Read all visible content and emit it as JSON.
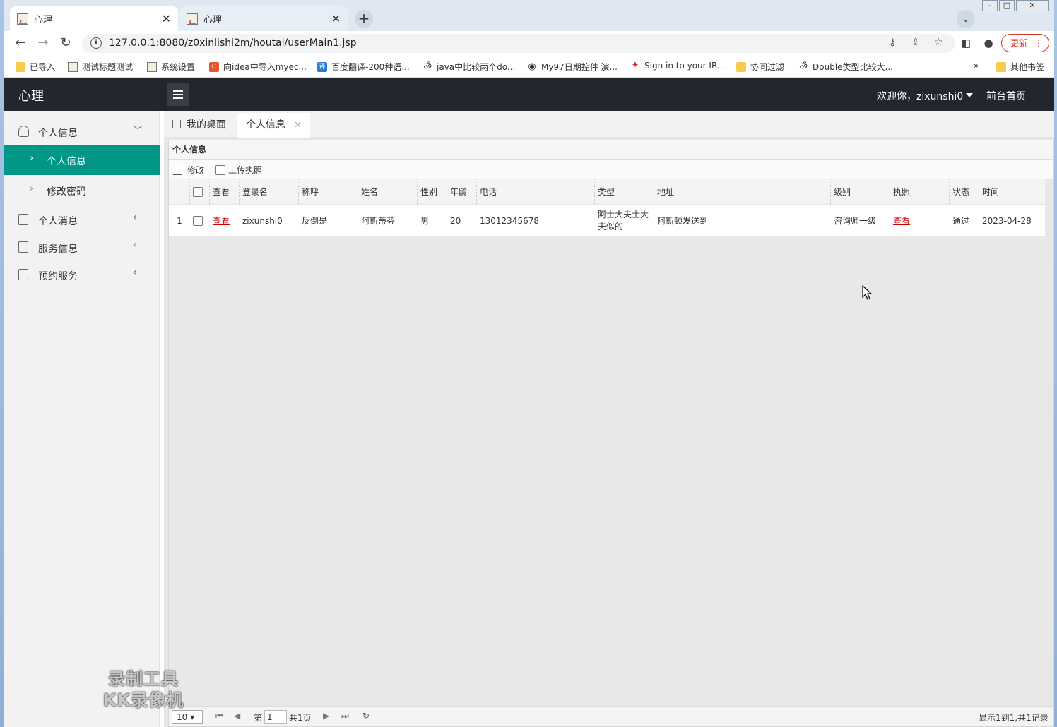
{
  "browser": {
    "tabs": [
      {
        "title": "心理"
      },
      {
        "title": "心理"
      }
    ],
    "url": "127.0.0.1:8080/z0xinlishi2m/houtai/userMain1.jsp",
    "update_label": "更新",
    "bookmarks": [
      {
        "label": "已导入",
        "icon": "folder-icon"
      },
      {
        "label": "测试标题测试",
        "icon": "page-icon"
      },
      {
        "label": "系统设置",
        "icon": "page-icon"
      },
      {
        "label": "向idea中导入myec...",
        "icon": "csdn-icon"
      },
      {
        "label": "百度翻译-200种语...",
        "icon": "translate-icon"
      },
      {
        "label": "java中比较两个do...",
        "icon": "om-icon"
      },
      {
        "label": "My97日期控件 演...",
        "icon": "globe-icon"
      },
      {
        "label": "Sign in to your IR...",
        "icon": "maple-leaf-icon"
      },
      {
        "label": "协同过滤",
        "icon": "folder-icon"
      },
      {
        "label": "Double类型比较大...",
        "icon": "om-icon"
      }
    ],
    "more_bookmarks": "»",
    "other_bookmarks": "其他书签"
  },
  "header": {
    "logo": "心理",
    "welcome": "欢迎你，zixunshi0",
    "home_link": "前台首页"
  },
  "sidebar": {
    "groups": [
      {
        "label": "个人信息",
        "icon": "user-icon",
        "expanded": true,
        "items": [
          {
            "label": "个人信息",
            "active": true
          },
          {
            "label": "修改密码",
            "active": false
          }
        ]
      },
      {
        "label": "个人消息",
        "icon": "document-icon",
        "expanded": false
      },
      {
        "label": "服务信息",
        "icon": "document-icon",
        "expanded": false
      },
      {
        "label": "预约服务",
        "icon": "document-icon",
        "expanded": false
      }
    ]
  },
  "content_tabs": [
    {
      "label": "我的桌面",
      "icon": "home-icon"
    },
    {
      "label": "个人信息",
      "active": true
    }
  ],
  "panel": {
    "title": "个人信息",
    "buttons": [
      {
        "label": "修改",
        "icon": "edit-icon"
      },
      {
        "label": "上传执照",
        "icon": "upload-icon"
      }
    ],
    "columns": [
      "查看",
      "登录名",
      "称呼",
      "姓名",
      "性别",
      "年龄",
      "电话",
      "类型",
      "地址",
      "级别",
      "执照",
      "状态",
      "时间"
    ],
    "rows": [
      {
        "index": "1",
        "view": "查看",
        "login": "zixunshi0",
        "nickname": "反倒是",
        "name": "阿斯蒂芬",
        "gender": "男",
        "age": "20",
        "phone": "13012345678",
        "type": "阿士大夫士大夫似的",
        "address": "阿斯顿发送到",
        "level": "咨询师一级",
        "license": "查看",
        "status": "通过",
        "time": "2023-04-28"
      }
    ],
    "pager": {
      "page_size": "10",
      "page_prefix": "第",
      "current_page": "1",
      "page_total": "共1页",
      "summary": "显示1到1,共1记录"
    }
  },
  "watermark": {
    "line1": "录制工具",
    "line2": "KK录像机"
  },
  "colors": {
    "topbar": "#23262e",
    "sidebar_active": "#009688",
    "link_red": "#c00"
  }
}
